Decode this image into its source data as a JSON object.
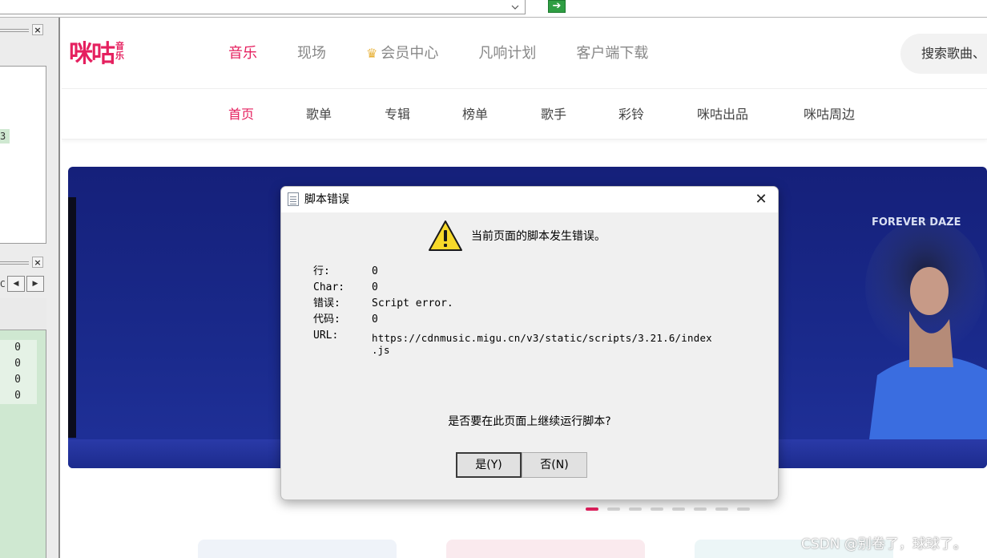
{
  "browser": {
    "address_value": "",
    "go_icon": "green-arrow-icon"
  },
  "devtools": {
    "line_value": "3",
    "values": [
      "0",
      "0",
      "0",
      "0"
    ],
    "nav_prefix": "C"
  },
  "site": {
    "logo_text": "咪咕",
    "logo_sub_1": "音",
    "logo_sub_2": "乐",
    "main_nav": [
      "音乐",
      "现场",
      "会员中心",
      "凡响计划",
      "客户端下载"
    ],
    "search_placeholder": "搜索歌曲、",
    "sub_nav": [
      "首页",
      "歌单",
      "专辑",
      "榜单",
      "歌手",
      "彩铃",
      "咪咕出品",
      "咪咕周边"
    ],
    "banner_artist": "FOREVER DAZE",
    "accent_color": "#e5205f"
  },
  "dialog": {
    "title": "脚本错误",
    "message": "当前页面的脚本发生错误。",
    "rows": [
      {
        "label": "行:",
        "value": "0"
      },
      {
        "label": "Char:",
        "value": "0"
      },
      {
        "label": "错误:",
        "value": "Script error."
      },
      {
        "label": "代码:",
        "value": "0"
      },
      {
        "label": "URL:",
        "value": "https://cdnmusic.migu.cn/v3/static/scripts/3.21.6/index",
        "value_cont": ".js"
      }
    ],
    "question": "是否要在此页面上继续运行脚本?",
    "yes_label": "是(Y)",
    "no_label": "否(N)"
  },
  "watermark": "CSDN @别卷了，球球了。"
}
